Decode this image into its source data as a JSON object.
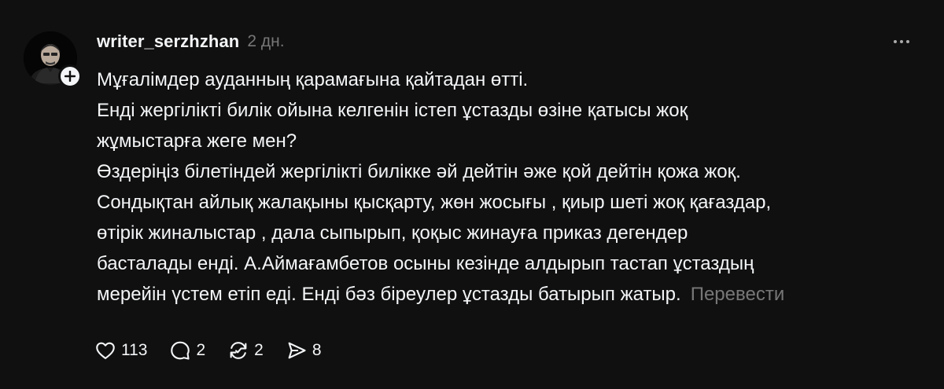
{
  "post": {
    "username": "writer_serzhzhan",
    "time": "2 дн.",
    "lines": [
      "Мұғалімдер ауданның қарамағына қайтадан өтті.",
      "Енді жергілікті билік ойына келгенін істеп ұстазды өзіне қатысы жоқ",
      "жұмыстарға жеге мен?",
      "Өздеріңіз білетіндей жергілікті билікке әй дейтін әже қой дейтін қожа жоқ.",
      "Сондықтан айлық жалақыны қысқарту, жөн жосығы , қиыр шеті жоқ қағаздар,",
      "өтірік жиналыстар , дала сыпырып, қоқыс жинауға приказ дегендер",
      "басталады енді. А.Аймағамбетов осыны кезінде алдырып тастап ұстаздың",
      "мерейін үстем етіп еді. Енді бәз біреулер ұстазды батырып жатыр."
    ],
    "translate_label": "Перевести"
  },
  "actions": {
    "likes": "113",
    "replies": "2",
    "reposts": "2",
    "shares": "8"
  },
  "icons": {
    "avatar": "avatar-image",
    "follow": "plus-icon",
    "more": "more-dots-icon",
    "like": "heart-icon",
    "reply": "comment-icon",
    "repost": "repost-icon",
    "share": "send-icon"
  }
}
